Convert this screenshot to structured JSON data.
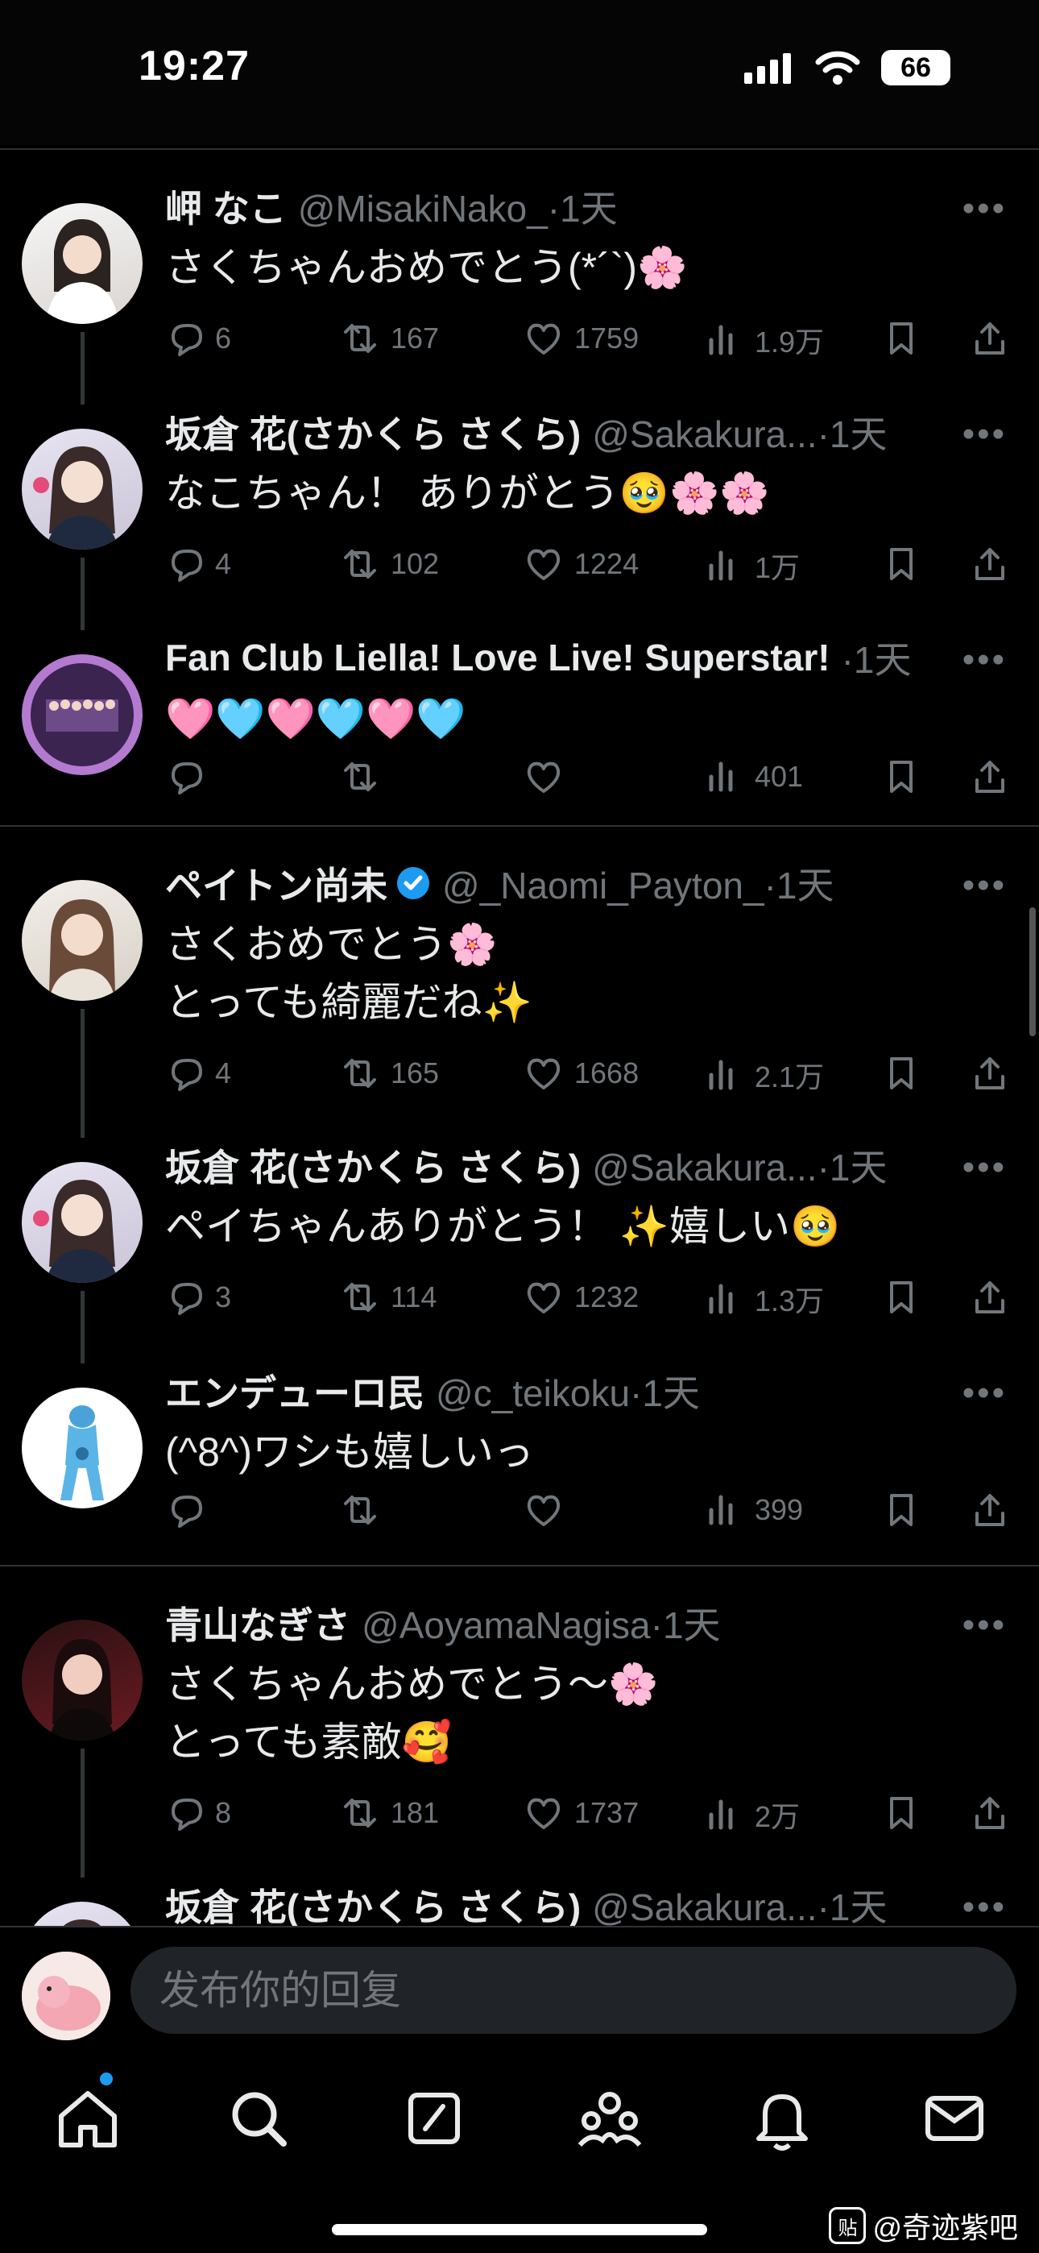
{
  "status_bar": {
    "time": "19:27",
    "battery": "66"
  },
  "tweets": [
    {
      "name": "岬 なこ",
      "handle": "@MisakiNako_·1天",
      "text": "さくちゃんおめでとう(*´`)🌸",
      "replies": "6",
      "retweets": "167",
      "likes": "1759",
      "views": "1.9万"
    },
    {
      "name": "坂倉 花(さかくら さくら)",
      "handle": "@Sakakura...·1天",
      "text": "なこちゃん！ ありがとう🥹🌸🌸",
      "replies": "4",
      "retweets": "102",
      "likes": "1224",
      "views": "1万"
    },
    {
      "name": "Fan Club Liella! Love Live! Superstar!",
      "handle": "·1天",
      "text": "🩷🩵🩷🩵🩷🩵",
      "replies": "",
      "retweets": "",
      "likes": "",
      "views": "401"
    },
    {
      "name": "ペイトン尚未",
      "handle": "@_Naomi_Payton_·1天",
      "text": "さくおめでとう🌸\nとっても綺麗だね✨",
      "replies": "4",
      "retweets": "165",
      "likes": "1668",
      "views": "2.1万"
    },
    {
      "name": "坂倉 花(さかくら さくら)",
      "handle": "@Sakakura...·1天",
      "text": "ペイちゃんありがとう！ ✨嬉しい🥹",
      "replies": "3",
      "retweets": "114",
      "likes": "1232",
      "views": "1.3万"
    },
    {
      "name": "エンデューロ民",
      "handle": "@c_teikoku·1天",
      "text": "(^8^)ワシも嬉しいっ",
      "replies": "",
      "retweets": "",
      "likes": "",
      "views": "399"
    },
    {
      "name": "青山なぎさ",
      "handle": "@AoyamaNagisa·1天",
      "text": "さくちゃんおめでとう～🌸\nとっても素敵🥰",
      "replies": "8",
      "retweets": "181",
      "likes": "1737",
      "views": "2万"
    },
    {
      "name": "坂倉 花(さかくら さくら)",
      "handle": "@Sakakura...·1天",
      "text": "",
      "replies": "",
      "retweets": "",
      "likes": "",
      "views": ""
    }
  ],
  "reply_bar": {
    "placeholder": "发布你的回复"
  },
  "watermark": {
    "text": "@奇迹紫吧",
    "icon_text": "贴"
  },
  "icons": {
    "tabs": [
      "home-icon",
      "search-icon",
      "compose-icon",
      "communities-icon",
      "notifications-icon",
      "messages-icon"
    ]
  },
  "colors": {
    "accent": "#1d9bf0",
    "background": "#000000",
    "secondary_text": "#71767b"
  }
}
